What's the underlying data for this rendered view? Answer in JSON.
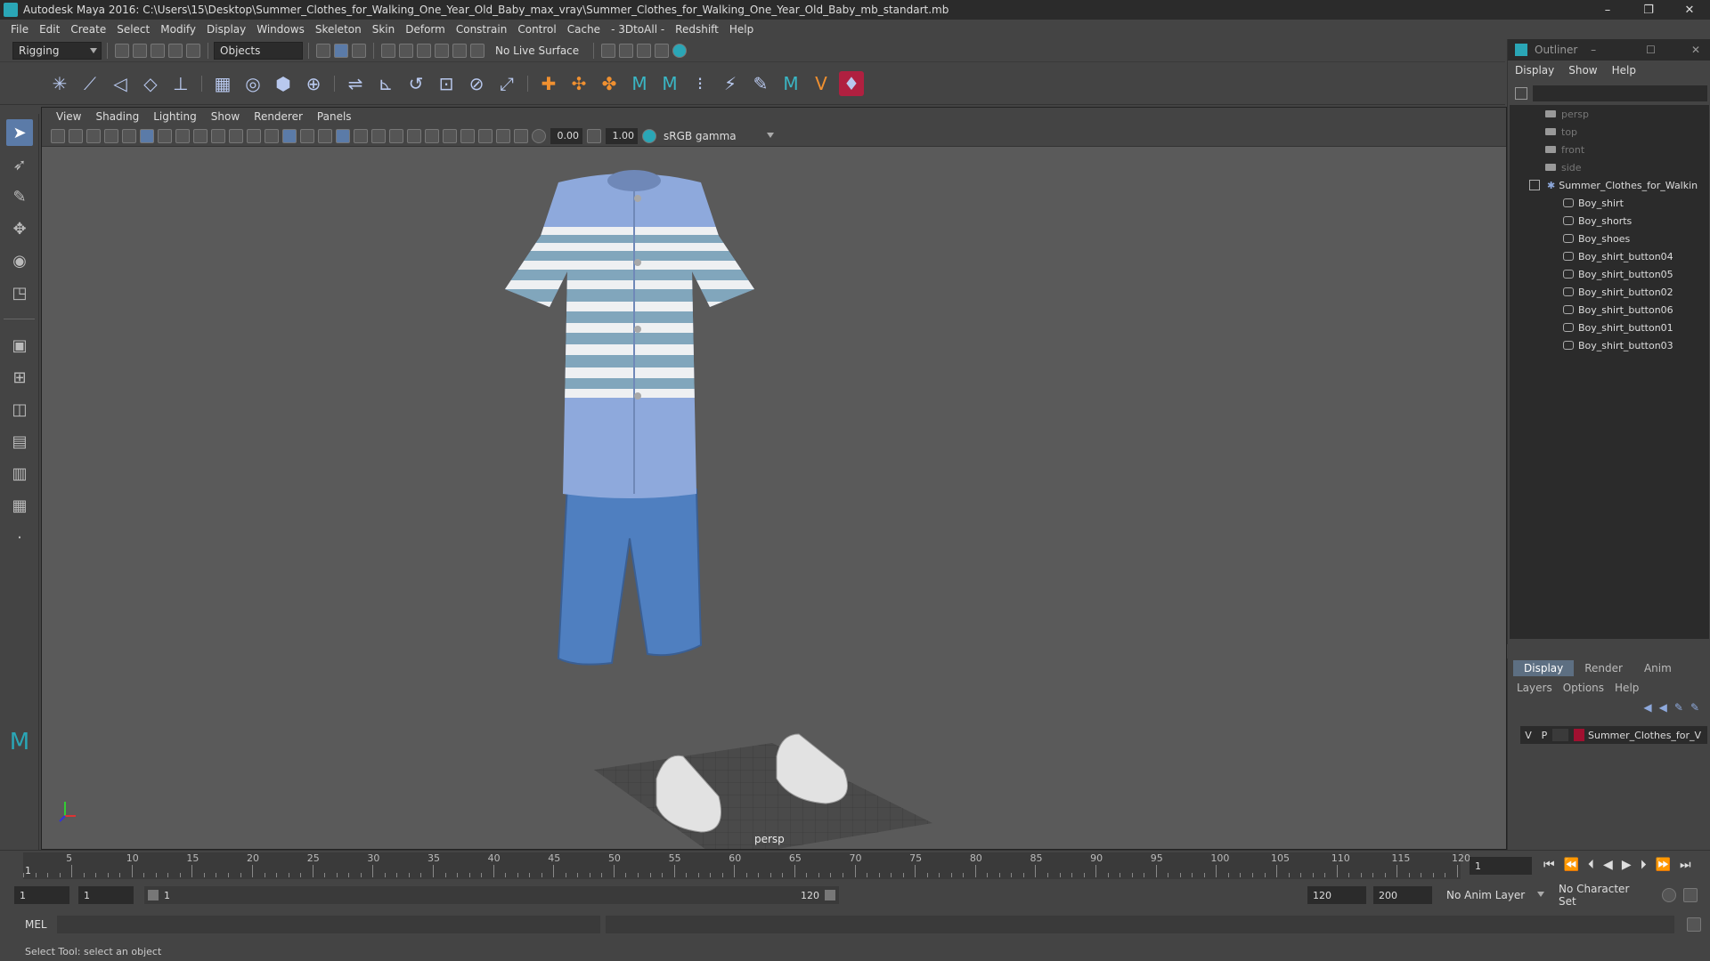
{
  "window": {
    "title": "Autodesk Maya 2016: C:\\Users\\15\\Desktop\\Summer_Clothes_for_Walking_One_Year_Old_Baby_max_vray\\Summer_Clothes_for_Walking_One_Year_Old_Baby_mb_standart.mb"
  },
  "menubar": [
    "File",
    "Edit",
    "Create",
    "Select",
    "Modify",
    "Display",
    "Windows",
    "Skeleton",
    "Skin",
    "Deform",
    "Constrain",
    "Control",
    "Cache",
    "- 3DtoAll -",
    "Redshift",
    "Help"
  ],
  "statusline": {
    "mode": "Rigging",
    "objects": "Objects",
    "live_surface": "No Live Surface"
  },
  "viewport": {
    "menu": [
      "View",
      "Shading",
      "Lighting",
      "Show",
      "Renderer",
      "Panels"
    ],
    "exposure": "0.00",
    "gamma": "1.00",
    "colorspace": "sRGB gamma",
    "camera": "persp"
  },
  "outliner": {
    "title": "Outliner",
    "menu": [
      "Display",
      "Show",
      "Help"
    ],
    "cameras": [
      "persp",
      "top",
      "front",
      "side"
    ],
    "group": "Summer_Clothes_for_Walkin",
    "children": [
      "Boy_shirt",
      "Boy_shorts",
      "Boy_shoes",
      "Boy_shirt_button04",
      "Boy_shirt_button05",
      "Boy_shirt_button02",
      "Boy_shirt_button06",
      "Boy_shirt_button01",
      "Boy_shirt_button03"
    ]
  },
  "layers": {
    "tabs": [
      "Display",
      "Render",
      "Anim"
    ],
    "menu": [
      "Layers",
      "Options",
      "Help"
    ],
    "row": {
      "v": "V",
      "p": "P",
      "name": "Summer_Clothes_for_V"
    }
  },
  "timeline": {
    "labels": [
      "5",
      "10",
      "15",
      "20",
      "25",
      "30",
      "35",
      "40",
      "45",
      "50",
      "55",
      "60",
      "65",
      "70",
      "75",
      "80",
      "85",
      "90",
      "95",
      "100",
      "105",
      "110",
      "115",
      "120"
    ],
    "start_tick": "1",
    "current_frame": "1"
  },
  "range": {
    "start": "1",
    "inner_start": "1",
    "slider_start": "1",
    "slider_end": "120",
    "end": "120",
    "anim_end": "200",
    "anim_layer": "No Anim Layer",
    "char_set": "No Character Set"
  },
  "cmd": {
    "lang": "MEL"
  },
  "help": "Select Tool: select an object",
  "colors": {
    "accent": "#5b7ba8",
    "layer": "#a01030",
    "shirt": "#8ea9dc",
    "stripe": "#7fa5b5",
    "shorts": "#4f7fc0"
  }
}
